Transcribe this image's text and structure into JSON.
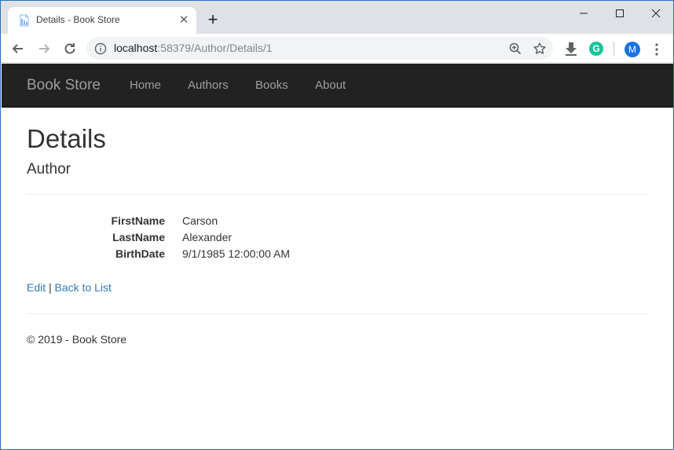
{
  "browser": {
    "tab": {
      "title": "Details - Book Store",
      "favicon": "page-icon"
    },
    "new_tab_label": "+",
    "window_controls": [
      "minimize-icon",
      "maximize-icon",
      "close-icon"
    ],
    "address": {
      "host": "localhost",
      "rest": ":58379/Author/Details/1"
    },
    "extensions": {
      "grammarly_letter": "G",
      "avatar_letter": "M"
    },
    "colors": {
      "accent": "#1a73e8",
      "grammarly": "#15c39a"
    }
  },
  "navbar": {
    "brand": "Book Store",
    "links": [
      "Home",
      "Authors",
      "Books",
      "About"
    ],
    "background": "#222222"
  },
  "page": {
    "title": "Details",
    "subtitle": "Author",
    "fields": [
      {
        "label": "FirstName",
        "value": "Carson"
      },
      {
        "label": "LastName",
        "value": "Alexander"
      },
      {
        "label": "BirthDate",
        "value": "9/1/1985 12:00:00 AM"
      }
    ],
    "actions": {
      "edit": "Edit",
      "separator": "|",
      "back": "Back to List"
    },
    "link_color": "#337ab7"
  },
  "footer": {
    "text": "© 2019 - Book Store"
  }
}
